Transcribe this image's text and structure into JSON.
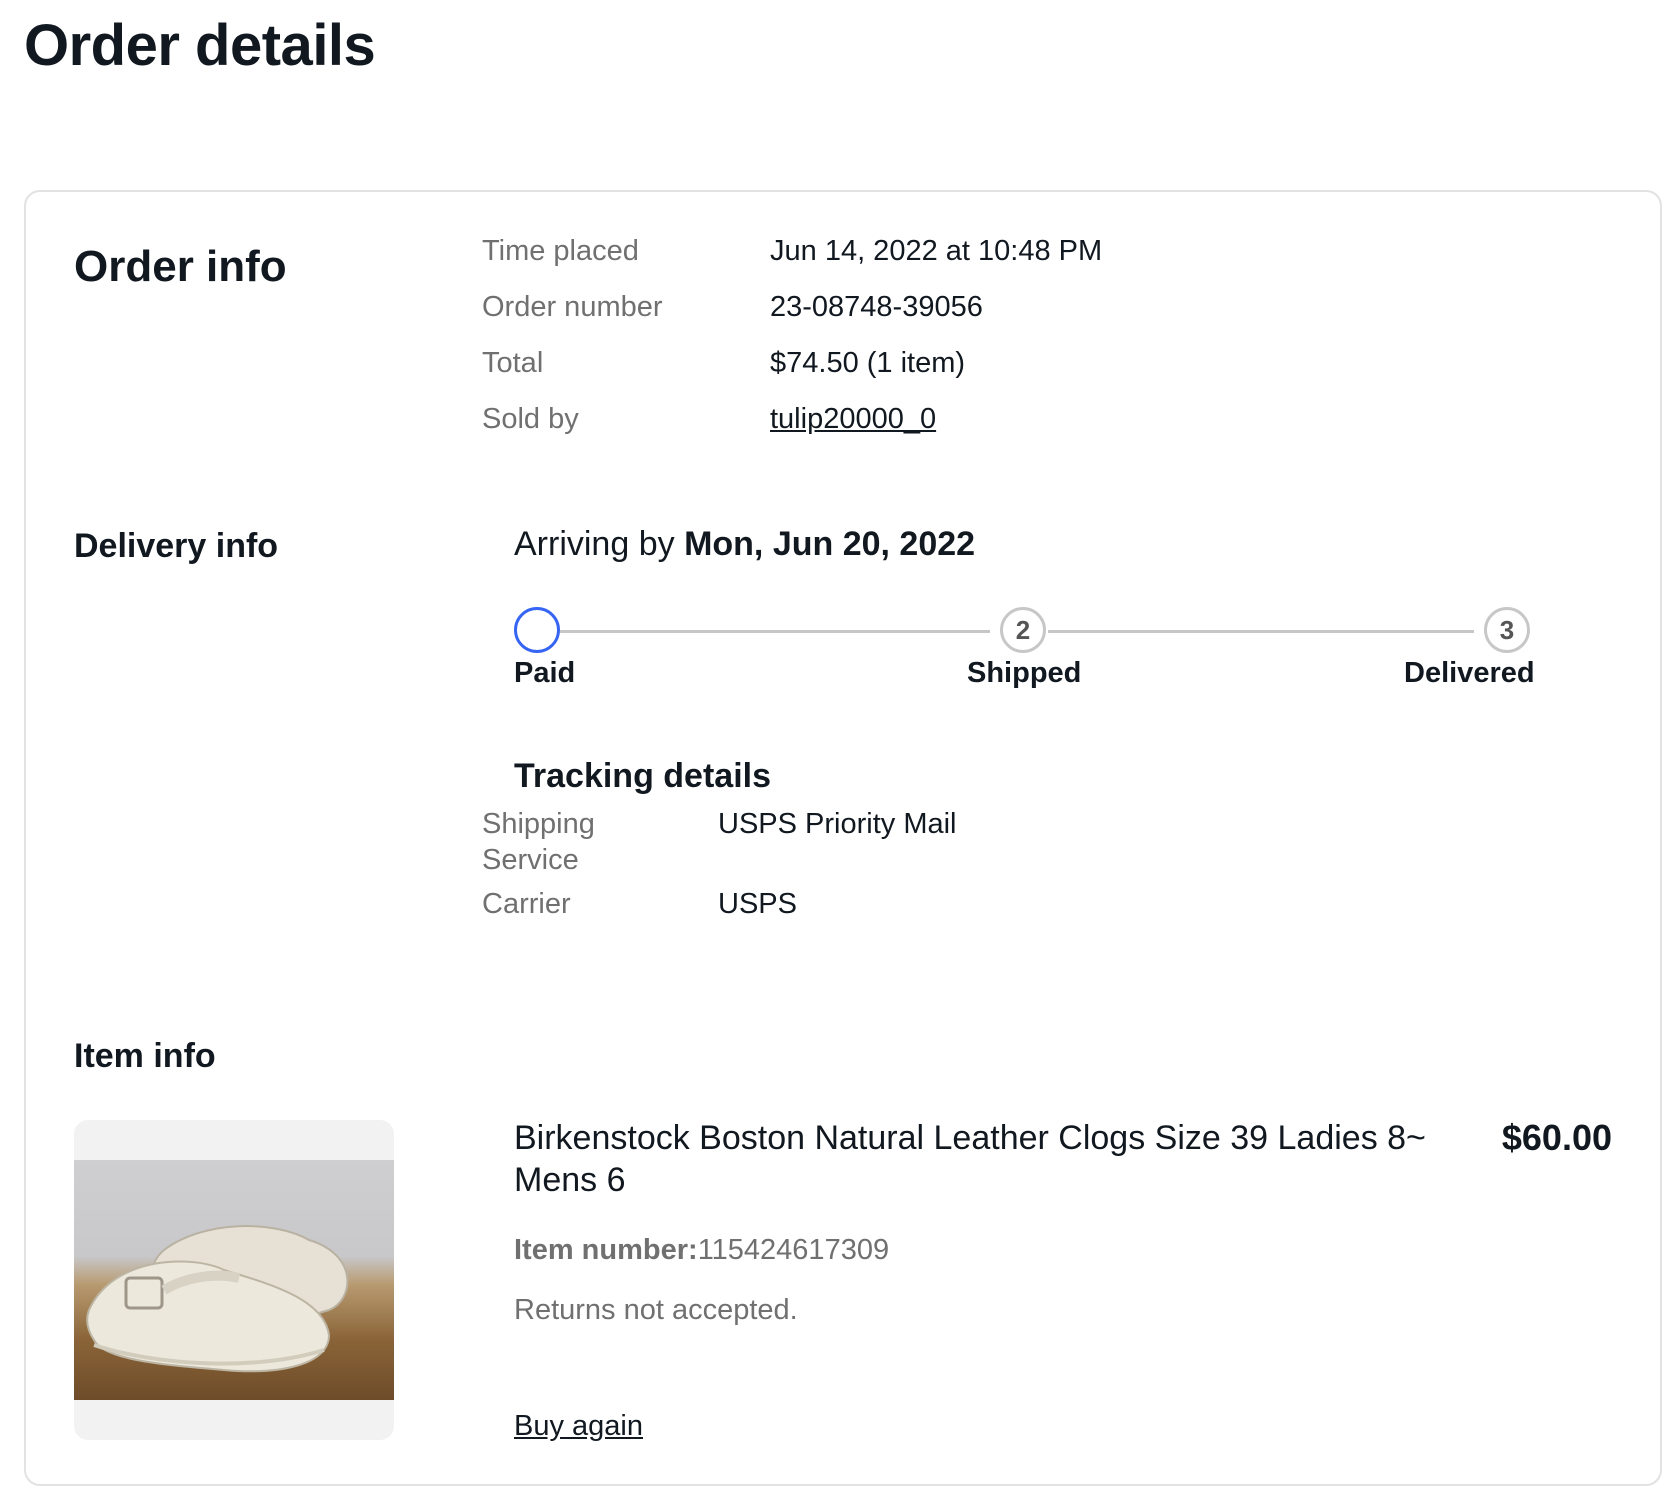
{
  "page": {
    "title": "Order details"
  },
  "order_info": {
    "heading": "Order info",
    "rows": [
      {
        "label": "Time placed",
        "value": "Jun 14, 2022 at 10:48 PM"
      },
      {
        "label": "Order number",
        "value": "23-08748-39056"
      },
      {
        "label": "Total",
        "value": "$74.50 (1 item)"
      },
      {
        "label": "Sold by",
        "value": "tulip20000_0"
      }
    ]
  },
  "delivery_info": {
    "heading": "Delivery info",
    "arriving_prefix": "Arriving by",
    "arriving_date": "Mon, Jun 20, 2022",
    "steps": [
      {
        "number": "",
        "label": "Paid",
        "state": "active"
      },
      {
        "number": "2",
        "label": "Shipped",
        "state": "pending"
      },
      {
        "number": "3",
        "label": "Delivered",
        "state": "pending"
      }
    ],
    "accent_color": "#3665f3",
    "tracking": {
      "heading": "Tracking details",
      "rows": [
        {
          "label": "Shipping Service",
          "value": "USPS Priority Mail"
        },
        {
          "label": "Carrier",
          "value": "USPS"
        }
      ]
    }
  },
  "item_info": {
    "heading": "Item info",
    "title": "Birkenstock Boston Natural Leather Clogs Size 39 Ladies 8~ Mens 6",
    "price": "$60.00",
    "item_number_label": "Item number:",
    "item_number": "115424617309",
    "returns": "Returns not accepted.",
    "buy_again": "Buy again"
  }
}
